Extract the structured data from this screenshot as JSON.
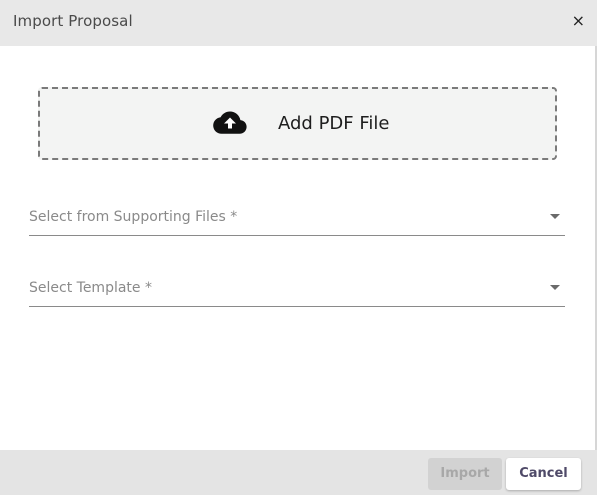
{
  "dialog": {
    "title": "Import Proposal",
    "close_symbol": "×"
  },
  "dropzone": {
    "icon": "cloud-upload-icon",
    "label": "Add PDF File"
  },
  "fields": {
    "supporting_files": {
      "label": "Select from Supporting Files *"
    },
    "template": {
      "label": "Select Template *"
    }
  },
  "footer": {
    "import_label": "Import",
    "cancel_label": "Cancel"
  },
  "colors": {
    "header_bg": "#e8e8e8",
    "dropzone_bg": "#f3f4f3",
    "cancel_text": "#4f4a68",
    "disabled_bg": "#d2d2d2"
  }
}
